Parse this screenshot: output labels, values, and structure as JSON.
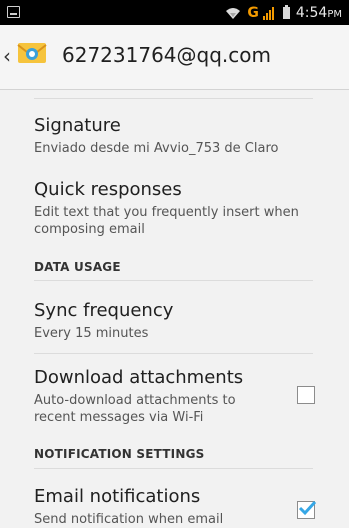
{
  "status": {
    "network": "G",
    "time": "4:54",
    "ampm": "PM"
  },
  "appbar": {
    "account": "627231764@qq.com",
    "icon": "mail-icon"
  },
  "settings": {
    "signature": {
      "title": "Signature",
      "summary": "Enviado desde mi Avvio_753 de Claro"
    },
    "quick_responses": {
      "title": "Quick responses",
      "summary": "Edit text that you frequently insert when composing email"
    },
    "data_usage_header": "DATA USAGE",
    "sync_frequency": {
      "title": "Sync frequency",
      "summary": "Every 15 minutes"
    },
    "download_attachments": {
      "title": "Download attachments",
      "summary": "Auto-download attachments to recent messages via Wi-Fi",
      "checked": false
    },
    "notification_header": "NOTIFICATION SETTINGS",
    "email_notifications": {
      "title": "Email notifications",
      "summary": "Send notification when email",
      "checked": true
    }
  },
  "colors": {
    "accent": "#36a7e6",
    "statusbar": "#000000",
    "network": "#f39a00"
  }
}
